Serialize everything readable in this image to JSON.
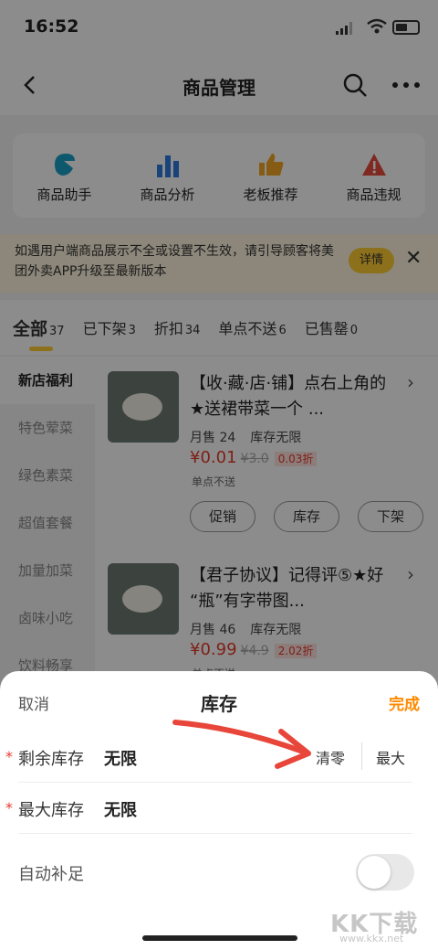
{
  "status_bar": {
    "time": "16:52"
  },
  "nav": {
    "title": "商品管理",
    "back_icon": "chevron-left-icon",
    "search_icon": "search-icon",
    "more_icon": "more-icon"
  },
  "tools": [
    {
      "label": "商品助手",
      "icon": "assistant-icon",
      "color": "#1aa0c8"
    },
    {
      "label": "商品分析",
      "icon": "bar-chart-icon",
      "color": "#2f7be0"
    },
    {
      "label": "老板推荐",
      "icon": "thumbs-up-icon",
      "color": "#f5a623"
    },
    {
      "label": "商品违规",
      "icon": "warning-icon",
      "color": "#e84c3d"
    }
  ],
  "notice": {
    "text": "如遇用户端商品展示不全或设置不生效，请引导顾客将美团外卖APP升级至最新版本",
    "detail_label": "详情"
  },
  "tabs": [
    {
      "label": "全部",
      "count": "37"
    },
    {
      "label": "已下架",
      "count": "3"
    },
    {
      "label": "折扣",
      "count": "34"
    },
    {
      "label": "单点不送",
      "count": "6"
    },
    {
      "label": "已售罄",
      "count": "0"
    }
  ],
  "categories": [
    "新店福利",
    "特色荤菜",
    "绿色素菜",
    "超值套餐",
    "加量加菜",
    "卤味小吃",
    "饮料畅享"
  ],
  "products": [
    {
      "name": "【收·藏·店·铺】点右上角的★送裙带菜一个 ...",
      "monthly_sales": "月售 24",
      "stock": "库存无限",
      "price": "¥0.01",
      "original_price": "¥3.0",
      "discount": "0.03折",
      "tag": "单点不送",
      "buttons": [
        "促销",
        "库存",
        "下架"
      ]
    },
    {
      "name": "【君子协议】记得评⑤★好 “瓶”有字带图...",
      "monthly_sales": "月售 46",
      "stock": "库存无限",
      "price": "¥0.99",
      "original_price": "¥4.9",
      "discount": "2.02折",
      "tag": "单点不送"
    }
  ],
  "sheet": {
    "cancel_label": "取消",
    "title": "库存",
    "done_label": "完成",
    "remaining": {
      "label": "剩余库存",
      "value": "无限",
      "clear_label": "清零",
      "max_label": "最大"
    },
    "max_stock": {
      "label": "最大库存",
      "value": "无限"
    },
    "auto_refill": {
      "label": "自动补足",
      "enabled": false
    }
  },
  "watermark": {
    "logo": "KK下载",
    "url": "www.kkx.net"
  },
  "colors": {
    "accent_yellow": "#ffcc33",
    "done_orange": "#ff8a00",
    "price_red": "#e83a2a",
    "annotation_red": "#e8463a"
  }
}
